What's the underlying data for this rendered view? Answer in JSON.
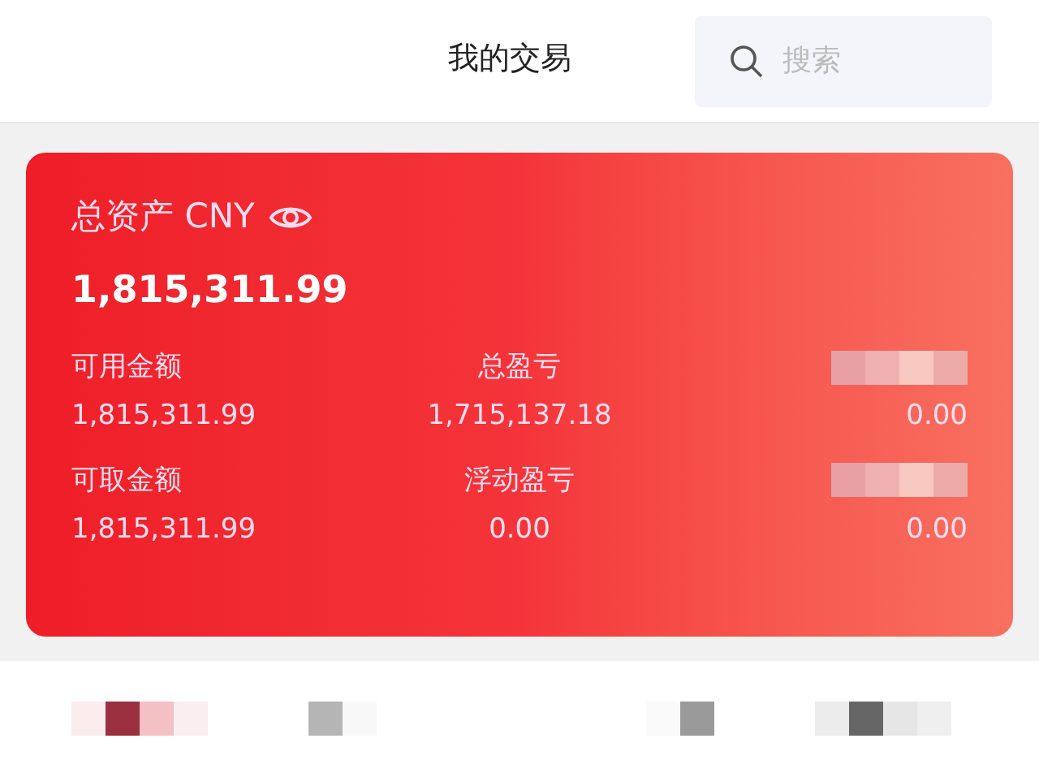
{
  "header": {
    "title": "我的交易",
    "search": {
      "placeholder": "搜索"
    }
  },
  "account": {
    "label": "总资产",
    "currency": "CNY",
    "amount": "1,815,311.99",
    "rows": [
      [
        {
          "label": "可用金额",
          "value": "1,815,311.99"
        },
        {
          "label": "总盈亏",
          "value": "1,715,137.18"
        },
        {
          "value": "0.00"
        }
      ],
      [
        {
          "label": "可取金额",
          "value": "1,815,311.99"
        },
        {
          "label": "浮动盈亏",
          "value": "0.00"
        },
        {
          "value": "0.00"
        }
      ]
    ]
  }
}
